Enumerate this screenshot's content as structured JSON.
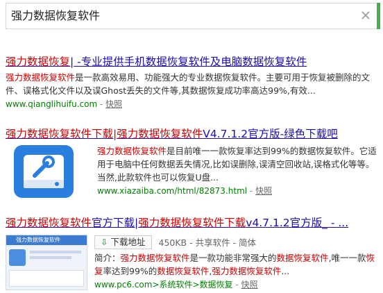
{
  "search": {
    "query": "强力数据恢复软件"
  },
  "results": [
    {
      "title_hl": "强力数据恢复",
      "title_rest": "| -专业提供手机数据恢复软件及电脑数据恢复软件",
      "snippet_hl": "强力数据恢复软件",
      "snippet_rest": "是一款高效易用、功能强大的专业数据恢复软件。主要可用于恢复被删除的文件、误格式化文件以及误Ghost丢失的文件等,其数据恢复成功率高达99%,有效...",
      "url": "www.qianglihuifu.com",
      "sep": " - ",
      "snapshot": "快照"
    },
    {
      "title_hl": "强力数据恢复软件下载",
      "title_mid": "|",
      "title_hl2": "强力数据恢复软件",
      "title_rest": "V4.7.1.2官方版-绿色下载吧",
      "snippet_hl": "强力数据恢复软件",
      "snippet_rest": "是目前唯一一款恢复率达到99%的数据恢复软件。它适用于电脑中任何数据丢失情况,比如误删除,误清空回收站,误格式化等等。当然,此款软件也可以恢复U盘...",
      "url": "www.xiazaiba.com/html/82873.html",
      "sep": " - ",
      "snapshot": "快照"
    },
    {
      "title_hl": "强力数据恢复软件",
      "title_plain1": "官方下载|",
      "title_hl2": "强力数据恢复软件下载",
      "title_rest": "v4.7.1.2官方版_ - ...",
      "download_label": "下载地址",
      "meta": "450KB - 共享软件 - 简体",
      "snippet_lead": "简介：",
      "snippet_hl": "强力数据恢复软件",
      "snippet_mid": "是一款功能非常强大的",
      "snippet_hl2": "数据恢复软件",
      "snippet_mid2": ",唯一一款",
      "snippet_hl3": "恢复",
      "snippet_mid3": "率达到99%的",
      "snippet_hl4": "数据恢复软件",
      "snippet_mid4": ",",
      "snippet_hl5": "强力数据恢复软件",
      "snippet_end": "...",
      "url": "www.pc6.com>系统软件>数据恢复",
      "sep": " - ",
      "snapshot": "快照",
      "thumb_text": "强力数据恢复软件"
    }
  ],
  "colors": {
    "title": "#1a0dab",
    "highlight": "#cc0000",
    "url": "#008000",
    "accent": "#43b14a"
  }
}
